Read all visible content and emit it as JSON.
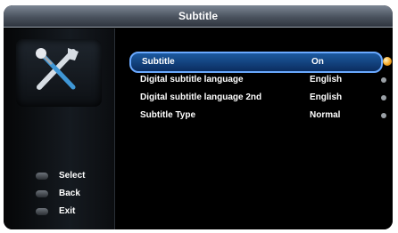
{
  "window": {
    "title": "Subtitle"
  },
  "legend": [
    {
      "label": "Select"
    },
    {
      "label": "Back"
    },
    {
      "label": "Exit"
    }
  ],
  "menu": {
    "items": [
      {
        "label": "Subtitle",
        "value": "On",
        "selected": true
      },
      {
        "label": "Digital subtitle language",
        "value": "English",
        "selected": false
      },
      {
        "label": "Digital subtitle language 2nd",
        "value": "English",
        "selected": false
      },
      {
        "label": "Subtitle Type",
        "value": "Normal",
        "selected": false
      }
    ]
  },
  "colors": {
    "selection": "#1c5aa0",
    "accent": "#f5a623",
    "background": "#000000"
  }
}
